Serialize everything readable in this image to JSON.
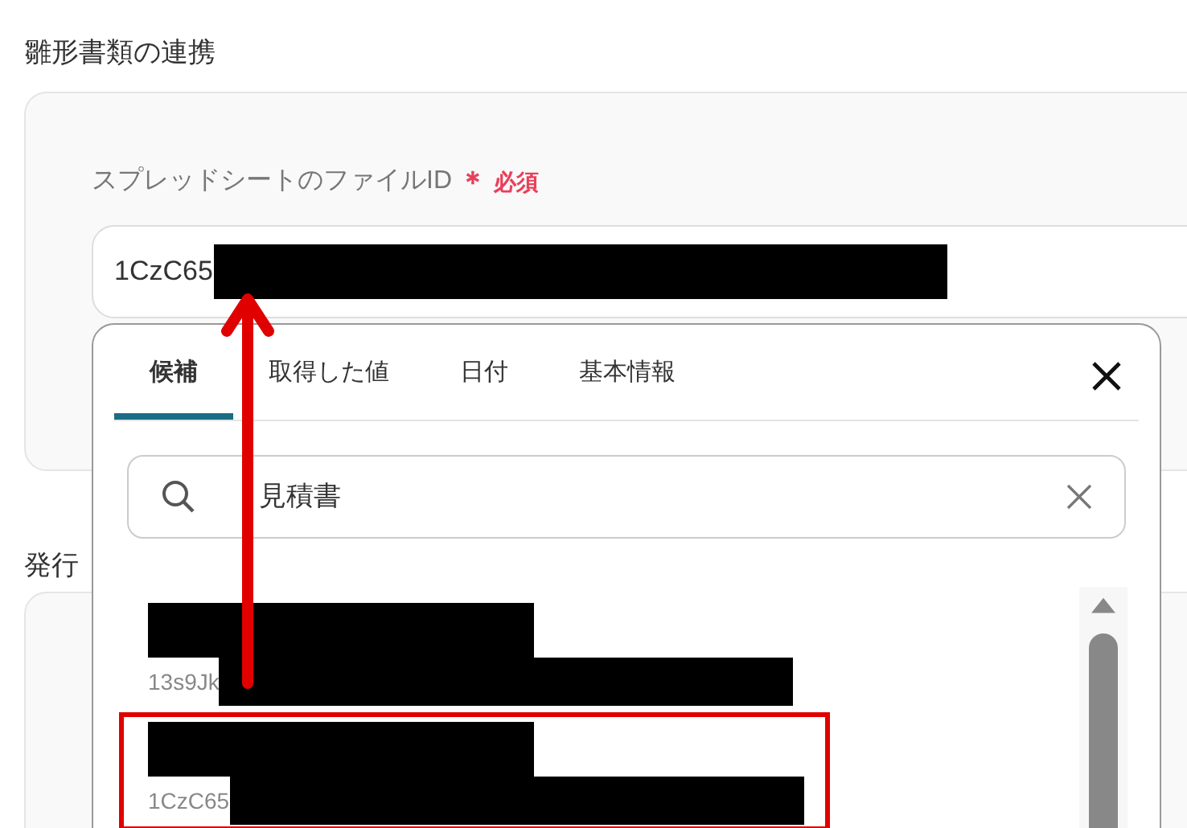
{
  "section_title": "雛形書類の連携",
  "field": {
    "label": "スプレッドシートのファイルID",
    "required_mark": "＊",
    "required_text": "必須",
    "value": "1CzC65"
  },
  "next_section_title": "発行",
  "popup": {
    "tabs": [
      {
        "label": "候補",
        "selected": true
      },
      {
        "label": "取得した値",
        "selected": false
      },
      {
        "label": "日付",
        "selected": false
      },
      {
        "label": "基本情報",
        "selected": false
      }
    ],
    "search": {
      "value": "見積書"
    },
    "results": [
      {
        "id_text": "13s9Jk",
        "highlighted": false
      },
      {
        "id_text": "1CzC65",
        "highlighted": true
      }
    ]
  }
}
